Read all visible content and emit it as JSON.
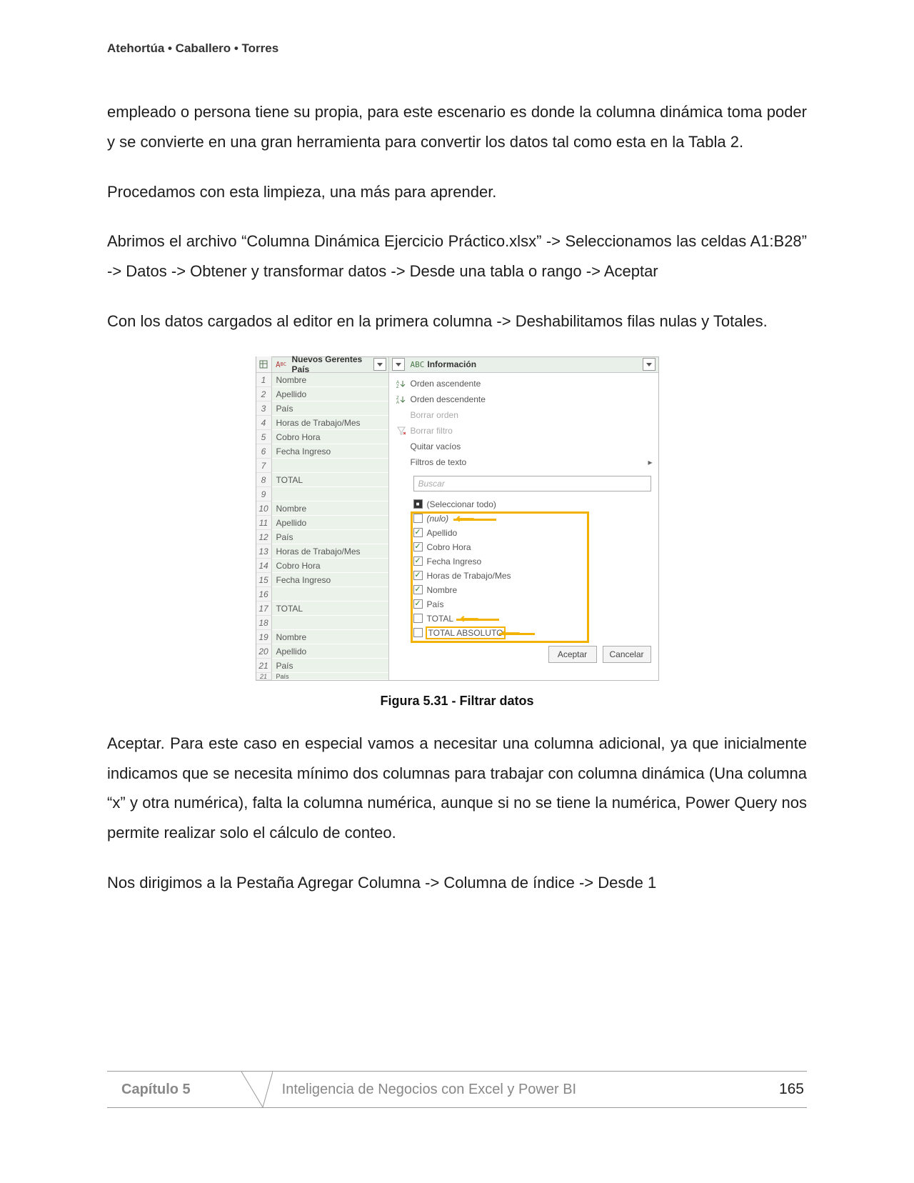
{
  "header": {
    "authors": "Atehortúa • Caballero • Torres"
  },
  "body": {
    "p1": "empleado o persona tiene su propia, para este escenario es donde la columna dinámica toma poder y se convierte en una gran herramienta para convertir los datos tal como esta en la Tabla 2.",
    "p2": "Procedamos con esta limpieza, una más para aprender.",
    "p3": "Abrimos el archivo “Columna Dinámica Ejercicio Práctico.xlsx” -> Seleccionamos las celdas A1:B28” -> Datos -> Obtener y transformar datos -> Desde una tabla o rango -> Aceptar",
    "p4": "Con los datos cargados al editor en la primera columna -> Deshabilitamos filas nulas y Totales.",
    "p5": "Aceptar. Para este caso en especial vamos a necesitar una columna adicional, ya que inicialmente indicamos que se necesita mínimo dos columnas para trabajar con columna dinámica (Una columna “x” y otra numérica), falta la columna numérica, aunque si no se tiene la numérica, Power Query nos permite realizar solo el cálculo de conteo.",
    "p6": "Nos dirigimos a la Pestaña Agregar Columna -> Columna de índice -> Desde 1"
  },
  "figure": {
    "col1_header": "Nuevos Gerentes País",
    "col2_header": "Información",
    "rows": [
      "Nombre",
      "Apellido",
      "País",
      "Horas de Trabajo/Mes",
      "Cobro Hora",
      "Fecha Ingreso",
      "",
      "TOTAL",
      "",
      "Nombre",
      "Apellido",
      "País",
      "Horas de Trabajo/Mes",
      "Cobro Hora",
      "Fecha Ingreso",
      "",
      "TOTAL",
      "",
      "Nombre",
      "Apellido",
      "País"
    ],
    "menu": {
      "asc": "Orden ascendente",
      "desc": "Orden descendente",
      "clear_sort": "Borrar orden",
      "clear_filter": "Borrar filtro",
      "remove_empty": "Quitar vacíos",
      "text_filters": "Filtros de texto"
    },
    "search_placeholder": "Buscar",
    "filters": {
      "select_all": "(Seleccionar todo)",
      "null": "(nulo)",
      "items": [
        "Apellido",
        "Cobro Hora",
        "Fecha Ingreso",
        "Horas de Trabajo/Mes",
        "Nombre",
        "País"
      ],
      "total": "TOTAL",
      "total_abs": "TOTAL ABSOLUTO"
    },
    "buttons": {
      "ok": "Aceptar",
      "cancel": "Cancelar"
    },
    "caption_prefix": "Figura 5.31 -  ",
    "caption_title": "Filtrar datos"
  },
  "footer": {
    "chapter": "Capítulo 5",
    "title": "Inteligencia de Negocios con Excel y Power BI",
    "page": "165"
  }
}
